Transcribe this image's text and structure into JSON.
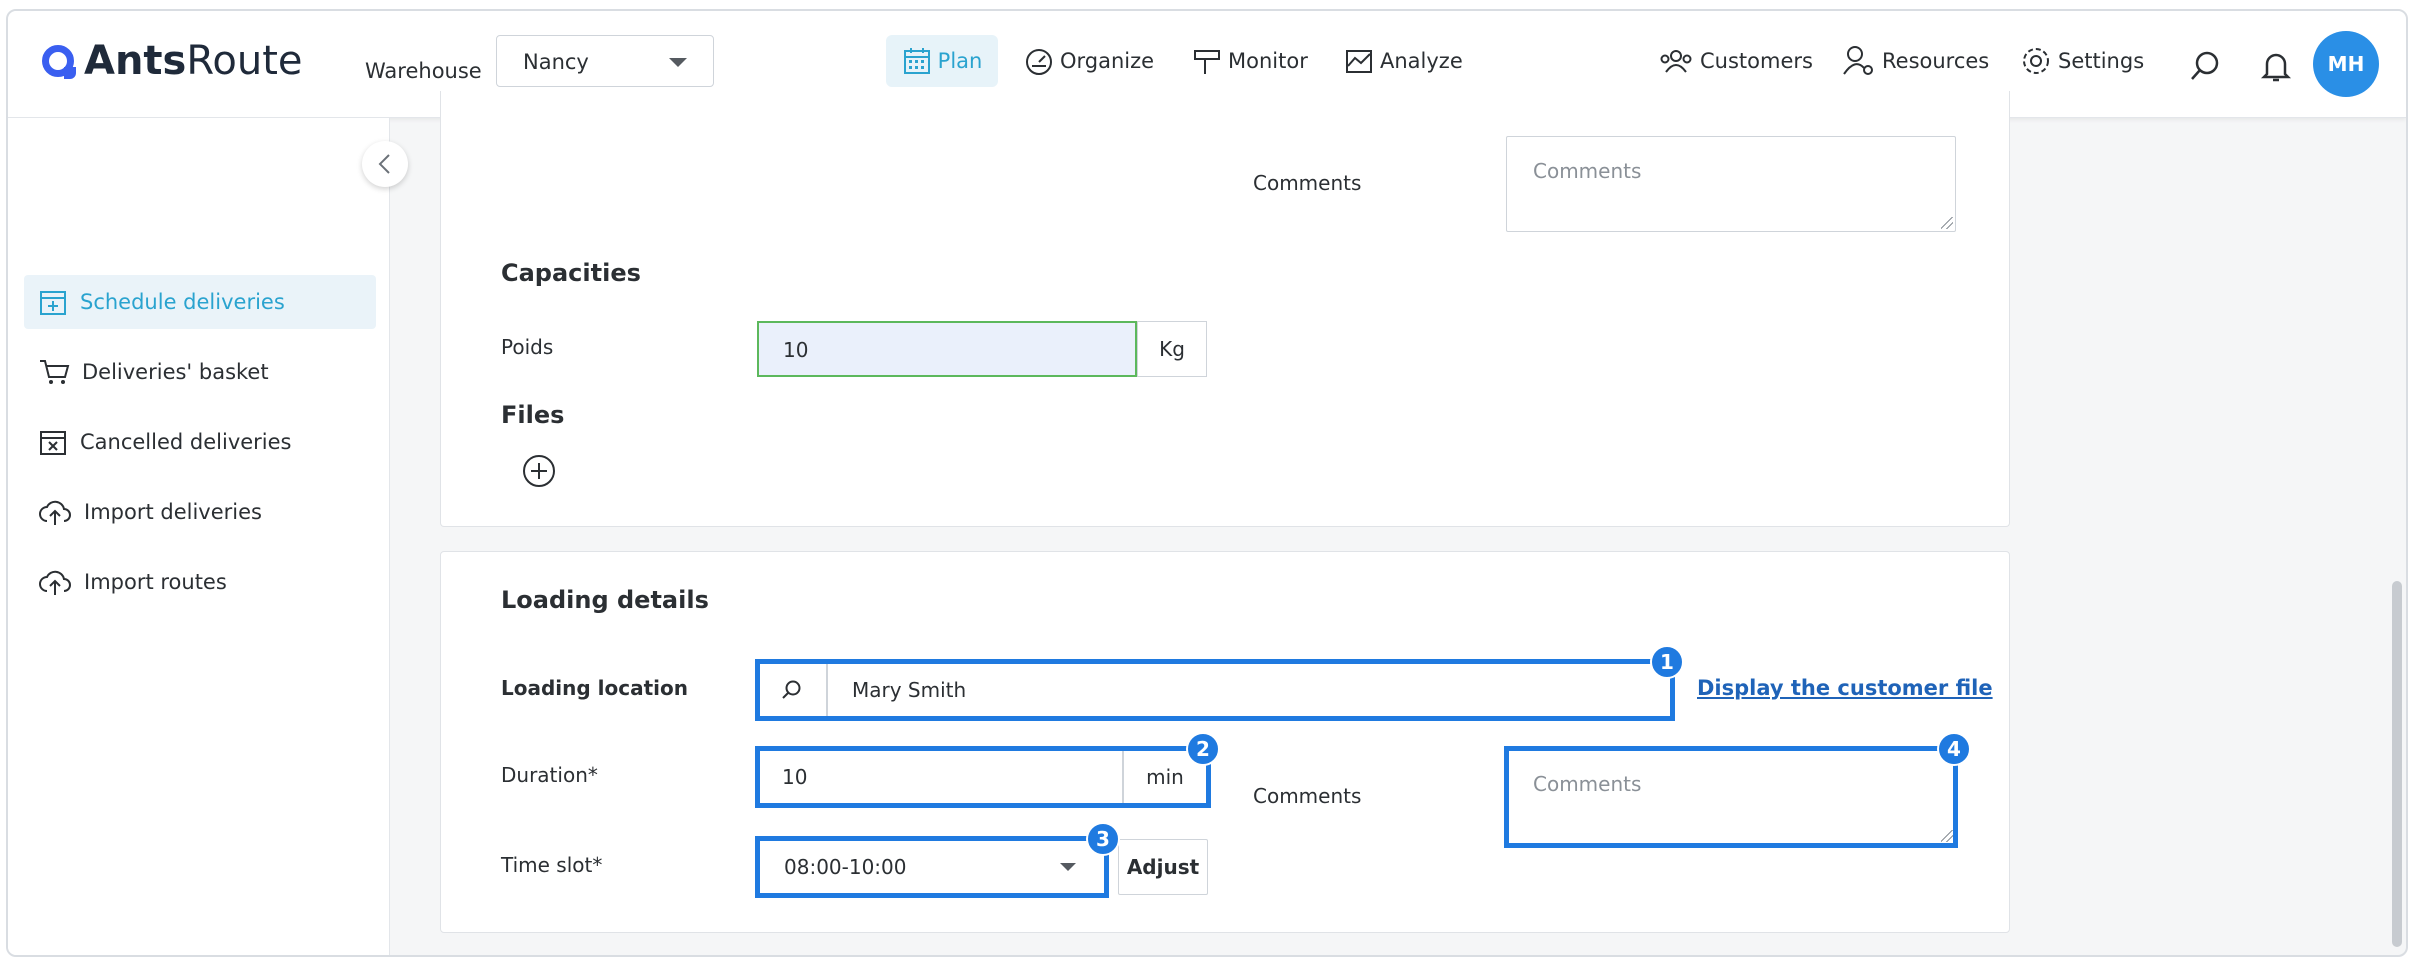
{
  "brand": {
    "name_bold": "Ants",
    "name_light": "Route"
  },
  "header": {
    "warehouse_label": "Warehouse",
    "warehouse_value": "Nancy",
    "nav": [
      {
        "label": "Plan",
        "icon": "calendar-icon",
        "active": true
      },
      {
        "label": "Organize",
        "icon": "gauge-icon"
      },
      {
        "label": "Monitor",
        "icon": "signpost-icon"
      },
      {
        "label": "Analyze",
        "icon": "chart-icon"
      },
      {
        "label": "Customers",
        "icon": "users-icon"
      },
      {
        "label": "Resources",
        "icon": "user-gear-icon"
      },
      {
        "label": "Settings",
        "icon": "gear-icon"
      }
    ],
    "avatar_initials": "MH"
  },
  "sidebar": {
    "items": [
      {
        "label": "Schedule deliveries",
        "icon": "calendar-plus-icon",
        "active": true
      },
      {
        "label": "Deliveries' basket",
        "icon": "cart-icon"
      },
      {
        "label": "Cancelled deliveries",
        "icon": "calendar-x-icon"
      },
      {
        "label": "Import deliveries",
        "icon": "cloud-upload-icon"
      },
      {
        "label": "Import routes",
        "icon": "cloud-upload-icon"
      }
    ]
  },
  "top_card": {
    "comments_label": "Comments",
    "comments_placeholder": "Comments",
    "capacities_title": "Capacities",
    "poids_label": "Poids",
    "poids_value": "10",
    "poids_unit": "Kg",
    "files_title": "Files"
  },
  "loading": {
    "title": "Loading details",
    "location_label": "Loading location",
    "location_value": "Mary Smith",
    "customer_file_link": "Display the customer file",
    "duration_label": "Duration*",
    "duration_value": "10",
    "duration_unit": "min",
    "comments_label": "Comments",
    "comments_placeholder": "Comments",
    "timeslot_label": "Time slot*",
    "timeslot_value": "08:00-10:00",
    "adjust_label": "Adjust"
  },
  "markers": [
    "1",
    "2",
    "3",
    "4"
  ],
  "colors": {
    "accent": "#2aa3cf",
    "highlight": "#1f7ae0",
    "brand": "#3a5ff0"
  }
}
